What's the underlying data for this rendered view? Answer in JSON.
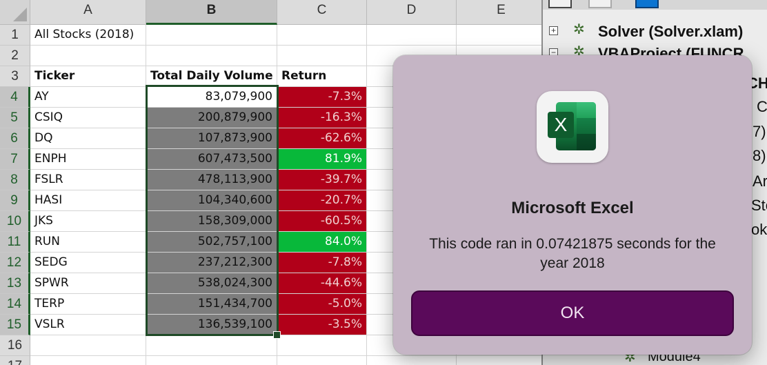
{
  "spreadsheet": {
    "columns": [
      "A",
      "B",
      "C",
      "D",
      "E"
    ],
    "row_numbers": [
      "1",
      "2",
      "3",
      "4",
      "5",
      "6",
      "7",
      "8",
      "9",
      "10",
      "11",
      "12",
      "13",
      "14",
      "15",
      "16",
      "17"
    ],
    "title_cell": "All Stocks (2018)",
    "headers": {
      "ticker": "Ticker",
      "volume": "Total Daily Volume",
      "return": "Return"
    },
    "rows": [
      {
        "ticker": "AY",
        "volume": "83,079,900",
        "return": "-7.3%",
        "status": "negative"
      },
      {
        "ticker": "CSIQ",
        "volume": "200,879,900",
        "return": "-16.3%",
        "status": "negative"
      },
      {
        "ticker": "DQ",
        "volume": "107,873,900",
        "return": "-62.6%",
        "status": "negative"
      },
      {
        "ticker": "ENPH",
        "volume": "607,473,500",
        "return": "81.9%",
        "status": "positive"
      },
      {
        "ticker": "FSLR",
        "volume": "478,113,900",
        "return": "-39.7%",
        "status": "negative"
      },
      {
        "ticker": "HASI",
        "volume": "104,340,600",
        "return": "-20.7%",
        "status": "negative"
      },
      {
        "ticker": "JKS",
        "volume": "158,309,000",
        "return": "-60.5%",
        "status": "negative"
      },
      {
        "ticker": "RUN",
        "volume": "502,757,100",
        "return": "84.0%",
        "status": "positive"
      },
      {
        "ticker": "SEDG",
        "volume": "237,212,300",
        "return": "-7.8%",
        "status": "negative"
      },
      {
        "ticker": "SPWR",
        "volume": "538,024,300",
        "return": "-44.6%",
        "status": "negative"
      },
      {
        "ticker": "TERP",
        "volume": "151,434,700",
        "return": "-5.0%",
        "status": "negative"
      },
      {
        "ticker": "VSLR",
        "volume": "136,539,100",
        "return": "-3.5%",
        "status": "negative"
      }
    ],
    "colors": {
      "negative_fill": "#b10019",
      "positive_fill": "#08b83a",
      "selection_border": "#1f4a27"
    }
  },
  "vba_project_pane": {
    "items": [
      {
        "label": "Solver (Solver.xlam)",
        "icon": "vba-project-icon"
      },
      {
        "label": "VBAProject (FUNCR",
        "icon": "vba-project-icon"
      }
    ],
    "partial_text": [
      "CH",
      "C",
      "7)",
      "8)",
      "Ar",
      "Sto",
      "ok"
    ],
    "bottom_item": "Module4"
  },
  "dialog": {
    "icon": "microsoft-excel-app-icon",
    "icon_letter": "X",
    "title": "Microsoft Excel",
    "message": "This code ran in 0.07421875 seconds for the year 2018",
    "ok_label": "OK",
    "colors": {
      "background": "#c5b5c5",
      "ok_button": "#5a0a5a"
    }
  }
}
